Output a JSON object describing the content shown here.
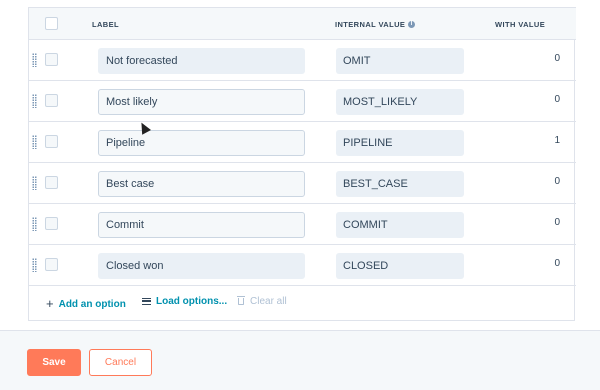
{
  "table": {
    "headers": {
      "label": "LABEL",
      "internal_value": "INTERNAL VALUE",
      "with_value": "WITH VALUE"
    },
    "rows": [
      {
        "label": "Not forecasted",
        "internal_value": "OMIT",
        "count": "0"
      },
      {
        "label": "Most likely",
        "internal_value": "MOST_LIKELY",
        "count": "0"
      },
      {
        "label": "Pipeline",
        "internal_value": "PIPELINE",
        "count": "1"
      },
      {
        "label": "Best case",
        "internal_value": "BEST_CASE",
        "count": "0"
      },
      {
        "label": "Commit",
        "internal_value": "COMMIT",
        "count": "0"
      },
      {
        "label": "Closed won",
        "internal_value": "CLOSED",
        "count": "0"
      }
    ]
  },
  "actions": {
    "add_option": "Add an option",
    "load_options": "Load options...",
    "clear_all": "Clear all"
  },
  "footer": {
    "save": "Save",
    "cancel": "Cancel"
  },
  "colors": {
    "accent": "#ff7a59",
    "link": "#0091ae",
    "text": "#33475b"
  }
}
